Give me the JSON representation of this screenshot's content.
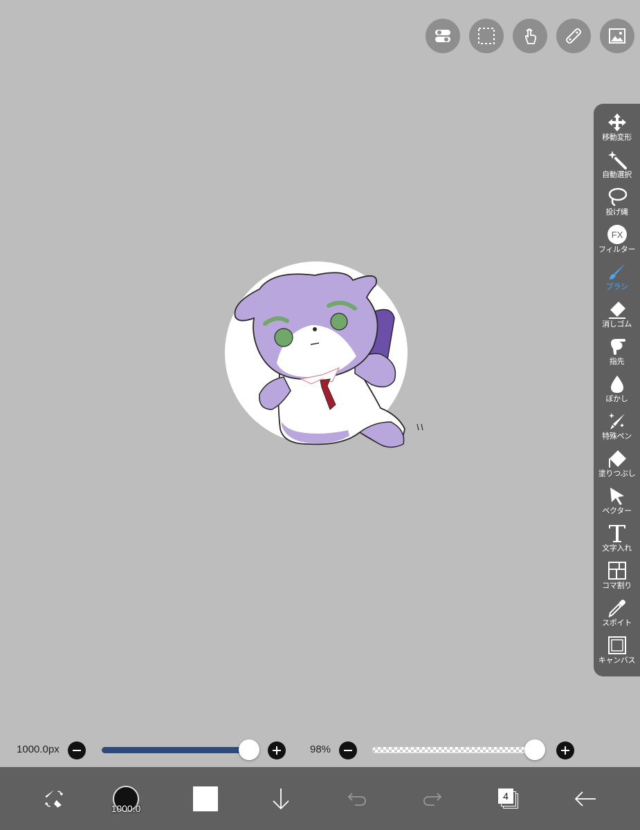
{
  "top_buttons": [
    {
      "name": "toggle-icon"
    },
    {
      "name": "selection-icon"
    },
    {
      "name": "touch-icon"
    },
    {
      "name": "ruler-icon"
    },
    {
      "name": "material-icon"
    }
  ],
  "tools": [
    {
      "label": "移動変形",
      "icon": "move-icon",
      "active": false
    },
    {
      "label": "自動選択",
      "icon": "magic-wand-icon",
      "active": false
    },
    {
      "label": "投げ縄",
      "icon": "lasso-icon",
      "active": false
    },
    {
      "label": "フィルター",
      "icon": "fx-icon",
      "active": false
    },
    {
      "label": "ブラシ",
      "icon": "brush-icon",
      "active": true
    },
    {
      "label": "消しゴム",
      "icon": "eraser-icon",
      "active": false
    },
    {
      "label": "指先",
      "icon": "finger-icon",
      "active": false
    },
    {
      "label": "ぼかし",
      "icon": "blur-icon",
      "active": false
    },
    {
      "label": "特殊ペン",
      "icon": "special-pen-icon",
      "active": false
    },
    {
      "label": "塗りつぶし",
      "icon": "fill-icon",
      "active": false
    },
    {
      "label": "ベクター",
      "icon": "vector-icon",
      "active": false
    },
    {
      "label": "文字入れ",
      "icon": "text-icon",
      "active": false
    },
    {
      "label": "コマ割り",
      "icon": "frame-divider-icon",
      "active": false
    },
    {
      "label": "スポイト",
      "icon": "eyedropper-icon",
      "active": false
    },
    {
      "label": "キャンバス",
      "icon": "canvas-icon",
      "active": false
    }
  ],
  "fx_text": "FX",
  "brush_size": {
    "label": "1000.0px",
    "value": 1000.0,
    "fraction": 1.0
  },
  "opacity": {
    "label": "98%",
    "value": 98,
    "fraction": 0.98
  },
  "bottom_bar": {
    "brush_preview_size": "1000.0",
    "layer_count": "4"
  },
  "colors": {
    "background": "#bdbdbd",
    "panel": "#5f5f5f",
    "active_tool": "#4da3f0",
    "size_track": "#2d4a78",
    "current_color": "#ffffff"
  }
}
